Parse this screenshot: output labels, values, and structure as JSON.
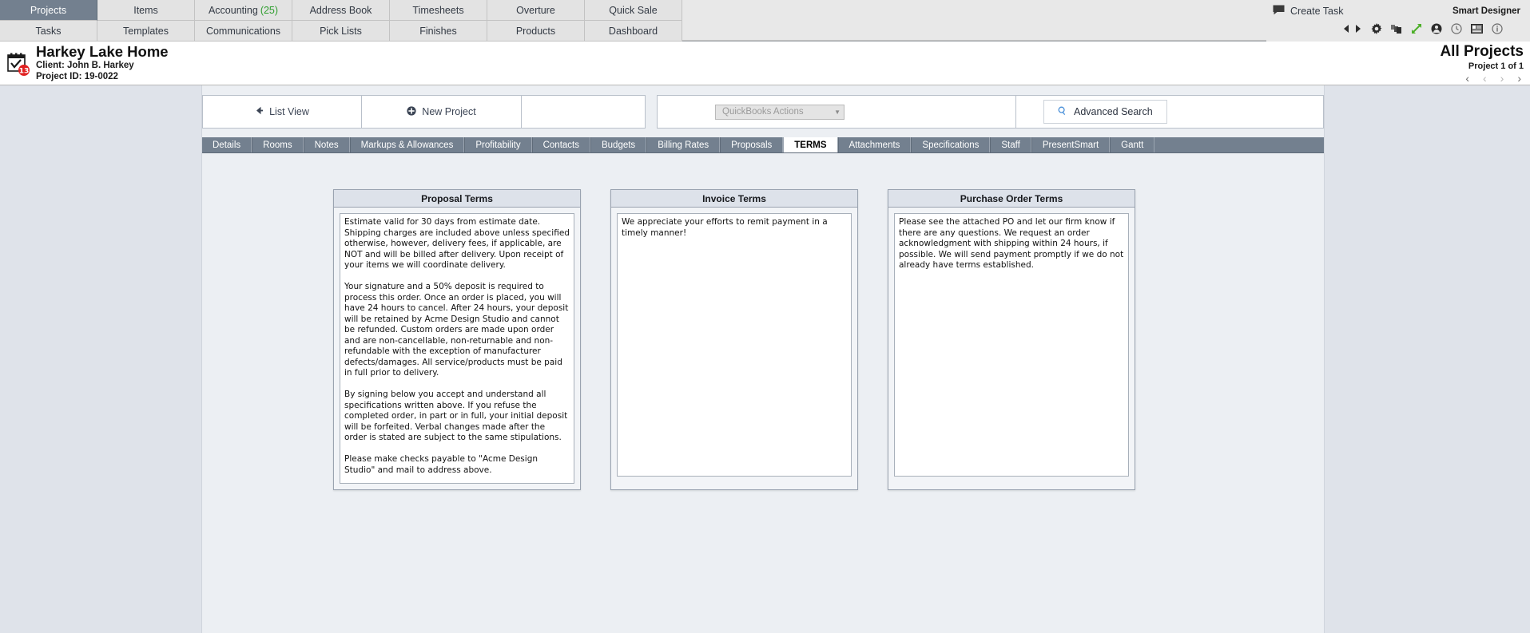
{
  "topnav": {
    "row1": [
      {
        "label": "Projects",
        "active": true
      },
      {
        "label": "Items",
        "active": false
      },
      {
        "label": "Accounting",
        "count": "(25)",
        "active": false
      },
      {
        "label": "Address Book",
        "active": false
      },
      {
        "label": "Timesheets",
        "active": false
      },
      {
        "label": "Overture",
        "active": false
      },
      {
        "label": "Quick Sale",
        "active": false
      }
    ],
    "row2": [
      {
        "label": "Tasks",
        "active": false
      },
      {
        "label": "Templates",
        "active": false
      },
      {
        "label": "Communications",
        "active": false
      },
      {
        "label": "Pick Lists",
        "active": false
      },
      {
        "label": "Finishes",
        "active": false
      },
      {
        "label": "Products",
        "active": false
      },
      {
        "label": "Dashboard",
        "active": false
      }
    ],
    "create_task": "Create Task",
    "smart_designer": "Smart Designer",
    "icons": [
      "back-arrow-icon",
      "forward-arrow-icon",
      "gear-icon",
      "copy-icon",
      "expand-icon",
      "user-icon",
      "clock-icon",
      "card-icon",
      "info-icon"
    ]
  },
  "project_header": {
    "title": "Harkey Lake Home",
    "client": "Client: John B. Harkey",
    "project_id": "Project ID: 19-0022",
    "scope": "All Projects",
    "position": "Project 1 of 1",
    "badge": "13"
  },
  "toolbar": {
    "list_view": "List View",
    "new_project": "New Project",
    "quickbooks_actions": "QuickBooks Actions",
    "advanced_search": "Advanced Search"
  },
  "tabs": [
    {
      "label": "Details",
      "active": false
    },
    {
      "label": "Rooms",
      "active": false
    },
    {
      "label": "Notes",
      "active": false
    },
    {
      "label": "Markups & Allowances",
      "active": false
    },
    {
      "label": "Profitability",
      "active": false
    },
    {
      "label": "Contacts",
      "active": false
    },
    {
      "label": "Budgets",
      "active": false
    },
    {
      "label": "Billing Rates",
      "active": false
    },
    {
      "label": "Proposals",
      "active": false
    },
    {
      "label": "TERMS",
      "active": true
    },
    {
      "label": "Attachments",
      "active": false
    },
    {
      "label": "Specifications",
      "active": false
    },
    {
      "label": "Staff",
      "active": false
    },
    {
      "label": "PresentSmart",
      "active": false
    },
    {
      "label": "Gantt",
      "active": false
    }
  ],
  "terms": {
    "proposal": {
      "title": "Proposal Terms",
      "text": "Estimate valid for 30 days from estimate date. Shipping charges are included above unless specified otherwise, however, delivery fees, if applicable, are NOT and will be billed after delivery. Upon receipt of your items we will coordinate delivery.\n\nYour signature and a 50% deposit is required to process this order. Once an order is placed, you will have 24 hours to cancel. After 24 hours, your deposit will be retained by Acme Design Studio and cannot be refunded. Custom orders are made upon order and are non-cancellable, non-returnable and non-refundable with the exception of manufacturer defects/damages. All service/products must be paid in full prior to delivery.\n\nBy signing below you accept and understand all specifications written above. If you refuse the completed order, in part or in full, your initial deposit will be forfeited. Verbal changes made after the order is stated are subject to the same stipulations.\n\nPlease make checks payable to \"Acme Design Studio\" and mail to address above."
    },
    "invoice": {
      "title": "Invoice Terms",
      "text": "We appreciate your efforts to remit payment in a timely manner!"
    },
    "purchase_order": {
      "title": "Purchase Order Terms",
      "text": "Please see the attached PO and let our firm know if there are any questions. We request an order acknowledgment with shipping within 24 hours, if possible. We will send payment promptly if we do not already have terms established."
    }
  },
  "colors": {
    "accent": "#73808f",
    "count_green": "#2f9e2f",
    "body_bg": "#dfe3ea",
    "panel_bg": "#eceff3"
  }
}
